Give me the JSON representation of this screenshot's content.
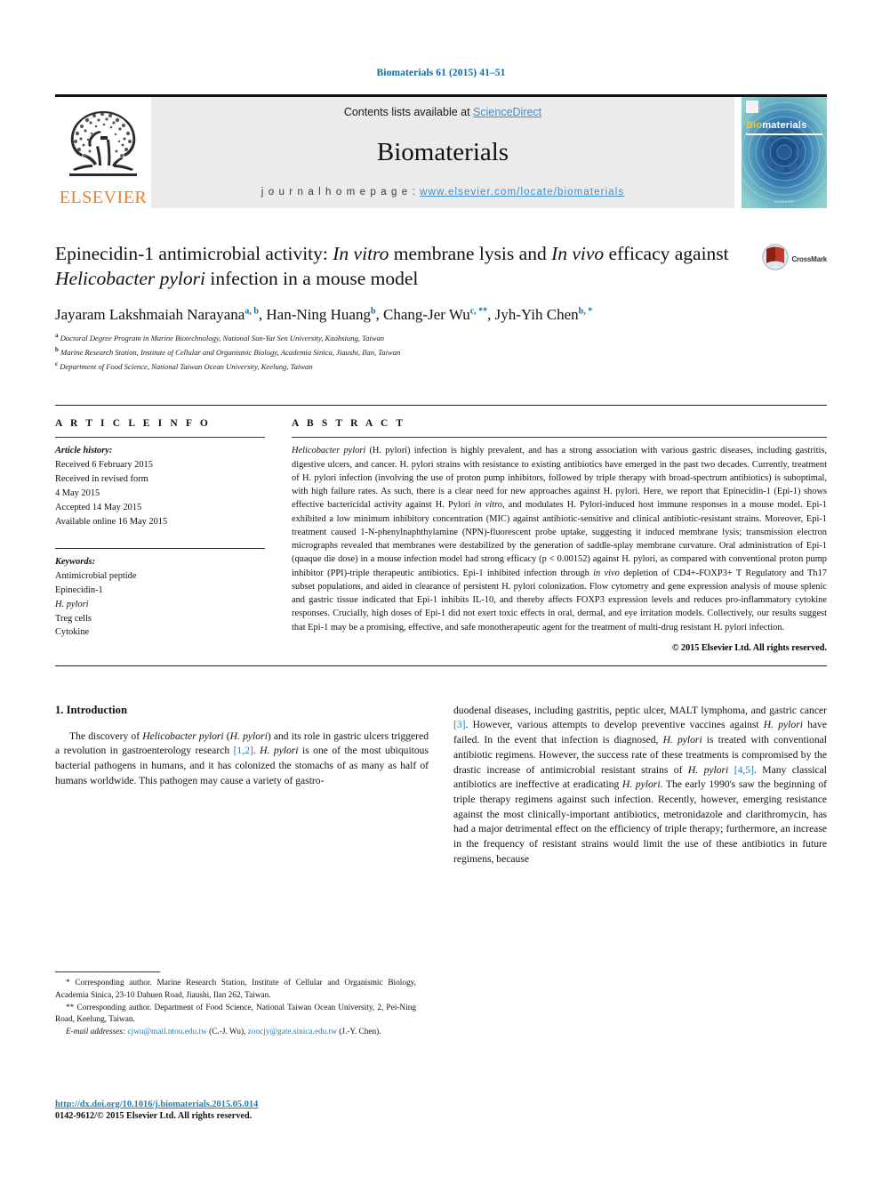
{
  "running_head": "Biomaterials 61 (2015) 41–51",
  "masthead": {
    "publisher_logo_name": "elsevier-tree-logo",
    "publisher_word": "ELSEVIER",
    "contents_prefix": "Contents lists available at ",
    "contents_link": "ScienceDirect",
    "journal_name": "Biomaterials",
    "homepage_label": "j o u r n a l   h o m e p a g e :  ",
    "homepage_url": "www.elsevier.com/locate/biomaterials",
    "cover_title_bio": "Bio",
    "cover_title_materials": "materials",
    "cover_footer": "ELSEVIER"
  },
  "title": {
    "part1": "Epinecidin-1 antimicrobial activity: ",
    "italic1": "In vitro",
    "part2": " membrane lysis and ",
    "italic2": "In vivo",
    "part3": " efficacy against ",
    "italic3": "Helicobacter pylori",
    "part4": " infection in a mouse model",
    "crossmark_label": "CrossMark"
  },
  "authors": {
    "list": [
      {
        "name": "Jayaram Lakshmaiah Narayana",
        "sup": "a, b"
      },
      {
        "name": "Han-Ning Huang",
        "sup": "b"
      },
      {
        "name": "Chang-Jer Wu",
        "sup": "c, **"
      },
      {
        "name": "Jyh-Yih Chen",
        "sup": "b, *"
      }
    ],
    "affiliations": [
      {
        "mark": "a",
        "text": "Doctoral Degree Program in Marine Biotechnology, National Sun-Yat Sen University, Kaohsiung, Taiwan"
      },
      {
        "mark": "b",
        "text": "Marine Research Station, Institute of Cellular and Organismic Biology, Academia Sinica, Jiaushi, Ilan, Taiwan"
      },
      {
        "mark": "c",
        "text": "Department of Food Science, National Taiwan Ocean University, Keelung, Taiwan"
      }
    ]
  },
  "article_info": {
    "label": "A R T I C L E   I N F O",
    "history_label": "Article history:",
    "history": [
      "Received 6 February 2015",
      "Received in revised form",
      "4 May 2015",
      "Accepted 14 May 2015",
      "Available online 16 May 2015"
    ],
    "keywords_label": "Keywords:",
    "keywords": [
      "Antimicrobial peptide",
      "Epinecidin-1",
      "H. pylori",
      "Treg cells",
      "Cytokine"
    ]
  },
  "abstract": {
    "label": "A B S T R A C T",
    "paragraph_segments": [
      {
        "t": "Helicobacter pylori",
        "i": true
      },
      {
        "t": " (H. pylori) infection is highly prevalent, and has a strong association with various gastric diseases, including gastritis, digestive ulcers, and cancer. H. pylori strains with resistance to existing antibiotics have emerged in the past two decades. Currently, treatment of H. pylori infection (involving the use of proton pump inhibitors, followed by triple therapy with broad-spectrum antibiotics) is suboptimal, with high failure rates. As such, there is a clear need for new approaches against H. pylori. Here, we report that Epinecidin-1 (Epi-1) shows effective bactericidal activity against H. Pylori ",
        "i": false
      },
      {
        "t": "in vitro",
        "i": true
      },
      {
        "t": ", and modulates H. Pylori-induced host immune responses in a mouse model. Epi-1 exhibited a low minimum inhibitory concentration (MIC) against antibiotic-sensitive and clinical antibiotic-resistant strains. Moreover, Epi-1 treatment caused 1-N-phenylnaphthylamine (NPN)-fluorescent probe uptake, suggesting it induced membrane lysis; transmission electron micrographs revealed that membranes were destabilized by the generation of saddle-splay membrane curvature. Oral administration of Epi-1 (quaque die dose) in a mouse infection model had strong efficacy (p < 0.00152) against H. pylori, as compared with conventional proton pump inhibitor (PPI)-triple therapeutic antibiotics. Epi-1 inhibited infection through ",
        "i": false
      },
      {
        "t": "in vivo",
        "i": true
      },
      {
        "t": " depletion of CD4+-FOXP3+ T Regulatory and Th17 subset populations, and aided in clearance of persistent H. pylori colonization. Flow cytometry and gene expression analysis of mouse splenic and gastric tissue indicated that Epi-1 inhibits IL-10, and thereby affects FOXP3 expression levels and reduces pro-inflammatory cytokine responses. Crucially, high doses of Epi-1 did not exert toxic effects in oral, dermal, and eye irritation models. Collectively, our results suggest that Epi-1 may be a promising, effective, and safe monotherapeutic agent for the treatment of multi-drug resistant H. pylori infection.",
        "i": false
      }
    ],
    "copyright": "© 2015 Elsevier Ltd. All rights reserved."
  },
  "introduction": {
    "heading": "1. Introduction",
    "left_segments": [
      {
        "t": "The discovery of ",
        "k": "plain"
      },
      {
        "t": "Helicobacter pylori",
        "k": "italic"
      },
      {
        "t": " (",
        "k": "plain"
      },
      {
        "t": "H. pylori",
        "k": "italic"
      },
      {
        "t": ") and its role in gastric ulcers triggered a revolution in gastroenterology research ",
        "k": "plain"
      },
      {
        "t": "[1,2]",
        "k": "ref"
      },
      {
        "t": ". ",
        "k": "plain"
      },
      {
        "t": "H. pylori",
        "k": "italic"
      },
      {
        "t": " is one of the most ubiquitous bacterial pathogens in humans, and it has colonized the stomachs of as many as half of humans worldwide. This pathogen may cause a variety of gastro-",
        "k": "plain"
      }
    ],
    "right_segments": [
      {
        "t": "duodenal diseases, including gastritis, peptic ulcer, MALT lymphoma, and gastric cancer ",
        "k": "plain"
      },
      {
        "t": "[3]",
        "k": "ref"
      },
      {
        "t": ". However, various attempts to develop preventive vaccines against ",
        "k": "plain"
      },
      {
        "t": "H. pylori",
        "k": "italic"
      },
      {
        "t": " have failed. In the event that infection is diagnosed, ",
        "k": "plain"
      },
      {
        "t": "H. pylori",
        "k": "italic"
      },
      {
        "t": " is treated with conventional antibiotic regimens. However, the success rate of these treatments is compromised by the drastic increase of antimicrobial resistant strains of ",
        "k": "plain"
      },
      {
        "t": "H. pylori",
        "k": "italic"
      },
      {
        "t": " ",
        "k": "plain"
      },
      {
        "t": "[4,5]",
        "k": "ref"
      },
      {
        "t": ". Many classical antibiotics are ineffective at eradicating ",
        "k": "plain"
      },
      {
        "t": "H. pylori",
        "k": "italic"
      },
      {
        "t": ". The early 1990's saw the beginning of triple therapy regimens against such infection. Recently, however, emerging resistance against the most clinically-important antibiotics, metronidazole and clarithromycin, has had a major detrimental effect on the efficiency of triple therapy; furthermore, an increase in the frequency of resistant strains would limit the use of these antibiotics in future regimens, because",
        "k": "plain"
      }
    ]
  },
  "footnotes": {
    "corresponding_1": "* Corresponding author. Marine Research Station, Institute of Cellular and Organismic Biology, Academia Sinica, 23-10 Dahuen Road, Jiaushi, Ilan 262, Taiwan.",
    "corresponding_2": "** Corresponding author. Department of Food Science, National Taiwan Ocean University, 2, Pei-Ning Road, Keelung, Taiwan.",
    "email_label": "E-mail addresses:",
    "email_1": "cjwu@mail.ntou.edu.tw",
    "email_1_owner": " (C.-J. Wu), ",
    "email_2": "zoocjy@gate.sinica.edu.tw",
    "email_2_owner": " (J.-Y. Chen)."
  },
  "footer": {
    "doi": "http://dx.doi.org/10.1016/j.biomaterials.2015.05.014",
    "issn": "0142-9612/© 2015 Elsevier Ltd. All rights reserved."
  },
  "colors": {
    "link_blue": "#1c7fb8",
    "sciencedirect_blue": "#3d8fd1",
    "elsevier_orange": "#ee7f24",
    "cover_blue": "#2f6fa8",
    "crossmark_red": "#c0392b"
  }
}
